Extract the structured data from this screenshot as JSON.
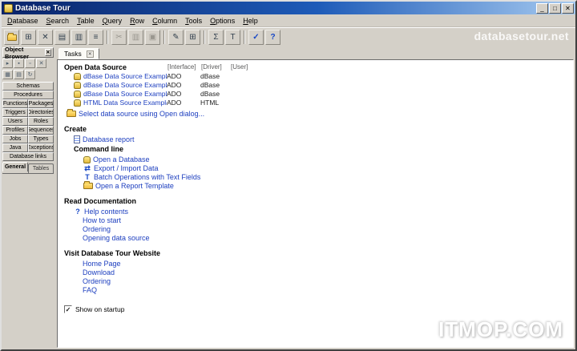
{
  "window": {
    "title": "Database Tour",
    "controls": {
      "minimize": "_",
      "maximize": "□",
      "close": "✕"
    }
  },
  "watermarks": {
    "toolbar": "databasetour.net",
    "page": "ITMOP.COM"
  },
  "menu": {
    "items": [
      "Database",
      "Search",
      "Table",
      "Query",
      "Row",
      "Column",
      "Tools",
      "Options",
      "Help"
    ]
  },
  "toolbar": {
    "glyphs": [
      "⊞",
      "✕",
      "▤",
      "▥",
      "≡",
      "✂",
      "▥",
      "▣",
      "✎",
      "⊞",
      "Σ",
      "T",
      "✓",
      "?"
    ]
  },
  "object_browser": {
    "title": "Object Browser",
    "close_glyph": "✕",
    "mini_row1": [
      "▸",
      "▪",
      "▫",
      "✕"
    ],
    "mini_row2": [
      "▦",
      "▤",
      "↻"
    ],
    "rows": [
      [
        "Schemas"
      ],
      [
        "Procedures"
      ],
      [
        "Functions",
        "Packages"
      ],
      [
        "Triggers",
        "Directories"
      ],
      [
        "Users",
        "Roles"
      ],
      [
        "Profiles",
        "Sequences"
      ],
      [
        "Jobs",
        "Types"
      ],
      [
        "Java",
        "Exceptions"
      ],
      [
        "Database links"
      ]
    ],
    "tabs": [
      "General",
      "Tables"
    ]
  },
  "tasks": {
    "tab_label": "Tasks",
    "tab_close_glyph": "✕",
    "open_data_source": {
      "title": "Open Data Source",
      "columns": [
        "[Interface]",
        "[Driver]",
        "[User]"
      ],
      "rows": [
        {
          "name": "dBase Data Source Example (ado-odbc)",
          "interface": "ADO",
          "driver": "dBase",
          "user": ""
        },
        {
          "name": "dBase Data Source Example (ado-directory)",
          "interface": "ADO",
          "driver": "dBase",
          "user": ""
        },
        {
          "name": "dBase Data Source Example (ado-jet)",
          "interface": "ADO",
          "driver": "dBase",
          "user": ""
        },
        {
          "name": "HTML Data Source Example",
          "interface": "ADO",
          "driver": "HTML",
          "user": ""
        }
      ],
      "open_dialog": "Select data source using Open dialog..."
    },
    "create": {
      "title": "Create",
      "database_report": "Database report",
      "command_line": "Command line",
      "items": [
        "Open a Database",
        "Export / Import Data",
        "Batch Operations with Text Fields",
        "Open a Report Template"
      ],
      "item_glyphs": [
        "",
        "⇄",
        "T",
        ""
      ]
    },
    "documentation": {
      "title": "Read Documentation",
      "help_glyph": "?",
      "items": [
        "Help contents",
        "How to start",
        "Ordering",
        "Opening data source"
      ]
    },
    "website": {
      "title": "Visit Database Tour Website",
      "items": [
        "Home Page",
        "Download",
        "Ordering",
        "FAQ"
      ]
    },
    "startup": {
      "label": "Show on startup",
      "checked": true,
      "check_glyph": "✓"
    }
  }
}
